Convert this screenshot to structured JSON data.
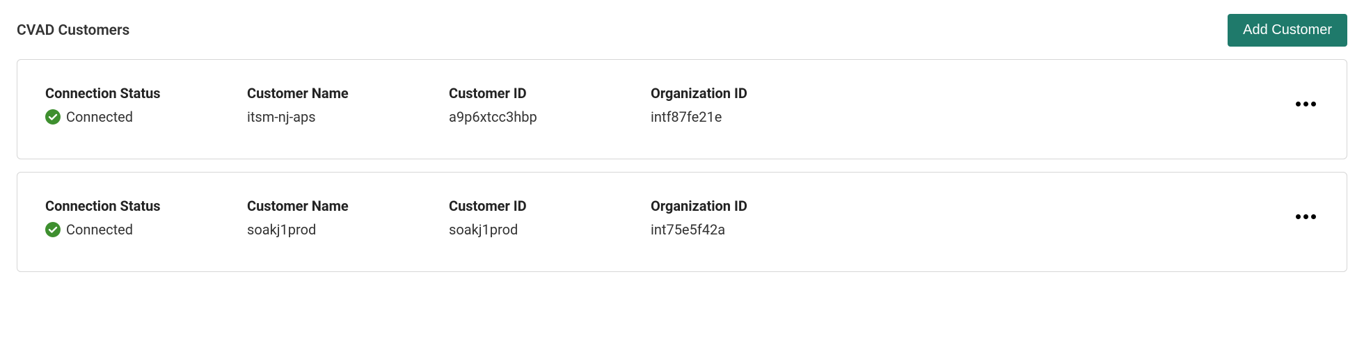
{
  "header": {
    "title": "CVAD Customers",
    "add_button_label": "Add Customer"
  },
  "labels": {
    "connection_status": "Connection Status",
    "customer_name": "Customer Name",
    "customer_id": "Customer ID",
    "organization_id": "Organization ID"
  },
  "status_colors": {
    "connected": "#3e8f2f"
  },
  "customers": [
    {
      "status_text": "Connected",
      "customer_name": "itsm-nj-aps",
      "customer_id": "a9p6xtcc3hbp",
      "organization_id": "intf87fe21e"
    },
    {
      "status_text": "Connected",
      "customer_name": "soakj1prod",
      "customer_id": "soakj1prod",
      "organization_id": "int75e5f42a"
    }
  ]
}
